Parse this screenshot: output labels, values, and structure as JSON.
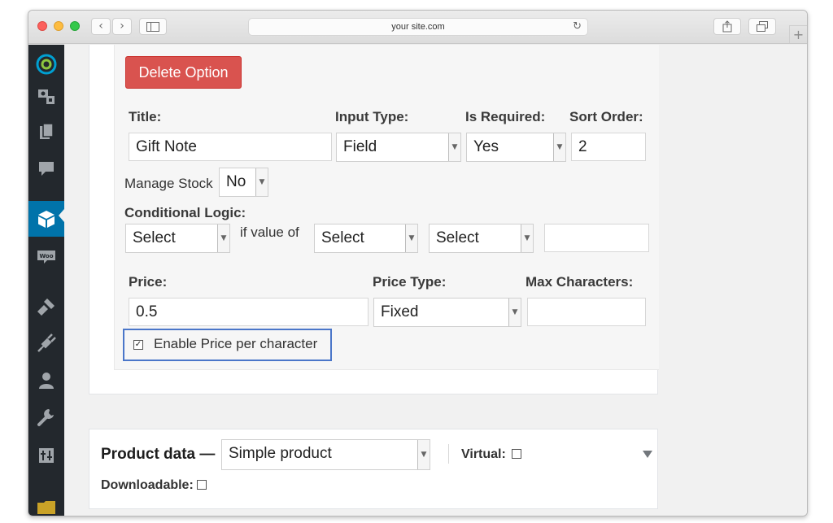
{
  "browser": {
    "url": "your site.com",
    "nav_back": "‹",
    "nav_forward": "›",
    "reload": "↻",
    "new_tab": "+"
  },
  "sidebar": {
    "icons": [
      "wordpress-logo-icon",
      "media-icon",
      "pages-icon",
      "comments-icon",
      "products-box-icon",
      "woocommerce-icon",
      "appearance-brush-icon",
      "plugins-icon",
      "users-icon",
      "tools-wrench-icon",
      "settings-sliders-icon",
      "folder-icon"
    ],
    "active_index": 4,
    "active_color": "#0073aa"
  },
  "option": {
    "delete_label": "Delete Option",
    "title_label": "Title:",
    "title_value": "Gift Note",
    "input_type_label": "Input Type:",
    "input_type_value": "Field",
    "is_required_label": "Is Required:",
    "is_required_value": "Yes",
    "sort_order_label": "Sort Order:",
    "sort_order_value": "2",
    "manage_stock_label": "Manage Stock",
    "manage_stock_value": "No",
    "conditional_logic_label": "Conditional Logic:",
    "cond_select_1": "Select",
    "if_value_of": "if value of",
    "cond_select_2": "Select",
    "cond_select_3": "Select",
    "cond_value": "",
    "price_label": "Price:",
    "price_value": "0.5",
    "price_type_label": "Price Type:",
    "price_type_value": "Fixed",
    "max_chars_label": "Max Characters:",
    "max_chars_value": "",
    "enable_price_per_char_label": "Enable Price per character",
    "enable_price_per_char_checked": true
  },
  "product_data": {
    "label": "Product data —",
    "type_value": "Simple product",
    "virtual_label": "Virtual:",
    "downloadable_label": "Downloadable:"
  },
  "colors": {
    "delete_button": "#d9534f",
    "highlight_border": "#4a76c9",
    "admin_bar": "#23282d"
  }
}
